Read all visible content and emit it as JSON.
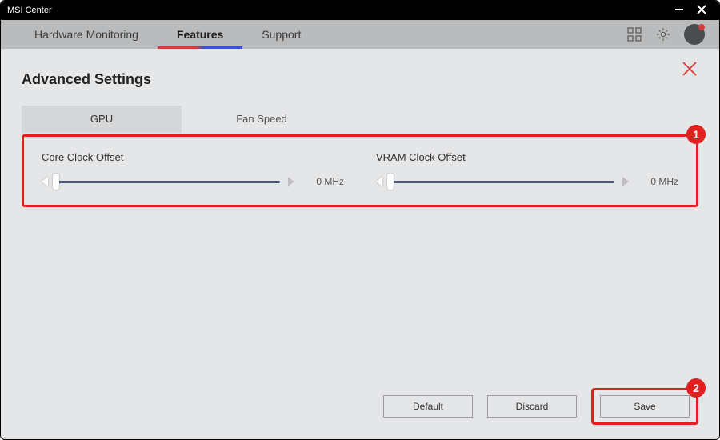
{
  "window": {
    "title": "MSI Center"
  },
  "topnav": {
    "tabs": [
      {
        "label": "Hardware Monitoring"
      },
      {
        "label": "Features"
      },
      {
        "label": "Support"
      }
    ],
    "active_index": 1
  },
  "page": {
    "title": "Advanced Settings"
  },
  "subtabs": {
    "items": [
      {
        "label": "GPU"
      },
      {
        "label": "Fan Speed"
      }
    ],
    "active_index": 0
  },
  "sliders": {
    "core": {
      "label": "Core Clock Offset",
      "value_text": "0 MHz"
    },
    "vram": {
      "label": "VRAM Clock Offset",
      "value_text": "0 MHz"
    }
  },
  "buttons": {
    "default": "Default",
    "discard": "Discard",
    "save": "Save"
  },
  "annotations": {
    "badge1": "1",
    "badge2": "2"
  }
}
